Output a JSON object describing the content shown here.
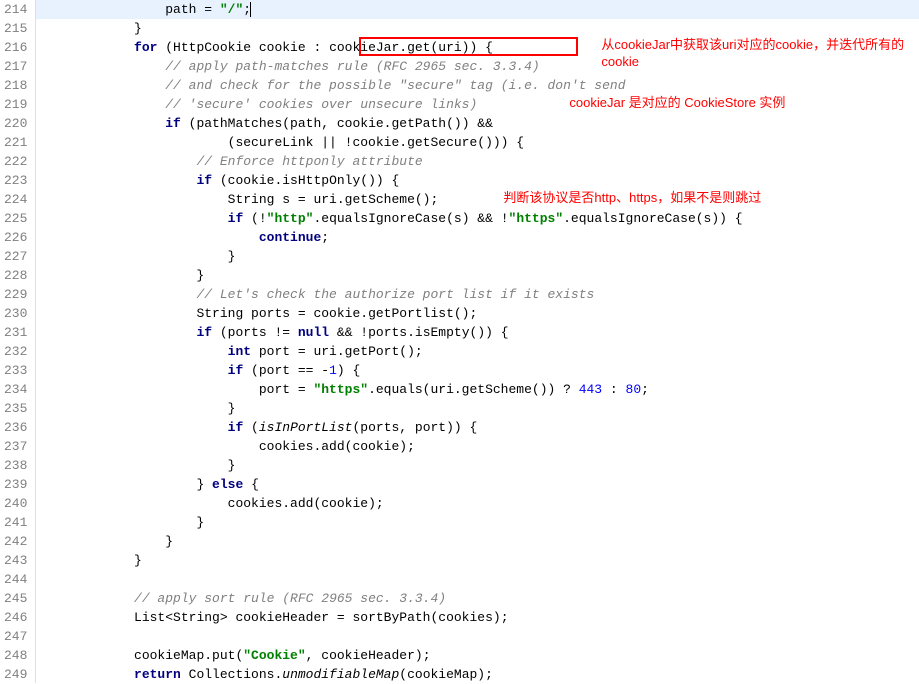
{
  "gutter": {
    "start": 214,
    "end": 249
  },
  "annotations": {
    "a1": "从cookieJar中获取该uri对应的cookie，并迭代所有的cookie",
    "a2": "cookieJar 是对应的 CookieStore 实例",
    "a3": "判断该协议是否http、https，如果不是则跳过"
  },
  "lines": {
    "l214": {
      "indent": "                ",
      "kw": "",
      "a": "path = ",
      "s": "\"/\"",
      "b": ";"
    },
    "l215": {
      "t": "            }"
    },
    "l216": {
      "indent": "            ",
      "kw": "for",
      "a": " (HttpCookie cookie : cookieJar.get(uri)) {"
    },
    "l217": {
      "indent": "                ",
      "cmt": "// apply path-matches rule (RFC 2965 sec. 3.3.4)"
    },
    "l218": {
      "indent": "                ",
      "cmt": "// and check for the possible \"secure\" tag (i.e. don't send"
    },
    "l219": {
      "indent": "                ",
      "cmt": "// 'secure' cookies over unsecure links)"
    },
    "l220": {
      "indent": "                ",
      "kw": "if",
      "a": " (pathMatches(path, cookie.getPath()) &&"
    },
    "l221": {
      "t": "                        (secureLink || !cookie.getSecure())) {"
    },
    "l222": {
      "indent": "                    ",
      "cmt": "// Enforce httponly attribute"
    },
    "l223": {
      "indent": "                    ",
      "kw": "if",
      "a": " (cookie.isHttpOnly()) {"
    },
    "l224": {
      "indent": "                        ",
      "a": "String s = uri.getScheme();"
    },
    "l225": {
      "indent": "                        ",
      "kw": "if",
      "a": " (!",
      "s1": "\"http\"",
      "b": ".equalsIgnoreCase(s) && !",
      "s2": "\"https\"",
      "c": ".equalsIgnoreCase(s)) {"
    },
    "l226": {
      "indent": "                            ",
      "kw": "continue",
      "a": ";"
    },
    "l227": {
      "t": "                        }"
    },
    "l228": {
      "t": "                    }"
    },
    "l229": {
      "indent": "                    ",
      "cmt": "// Let's check the authorize port list if it exists"
    },
    "l230": {
      "indent": "                    ",
      "a": "String ports = cookie.getPortlist();"
    },
    "l231": {
      "indent": "                    ",
      "kw": "if",
      "a": " (ports != ",
      "kw2": "null",
      "b": " && !ports.isEmpty()) {"
    },
    "l232": {
      "indent": "                        ",
      "kw": "int",
      "a": " port = uri.getPort();"
    },
    "l233": {
      "indent": "                        ",
      "kw": "if",
      "a": " (port == -",
      "n": "1",
      "b": ") {"
    },
    "l234": {
      "indent": "                            ",
      "a": "port = ",
      "s": "\"https\"",
      "b": ".equals(uri.getScheme()) ? ",
      "n1": "443",
      "c": " : ",
      "n2": "80",
      "d": ";"
    },
    "l235": {
      "t": "                        }"
    },
    "l236": {
      "indent": "                        ",
      "kw": "if",
      "a": " (",
      "m": "isInPortList",
      "b": "(ports, port)) {"
    },
    "l237": {
      "indent": "                            ",
      "a": "cookies.add(cookie);"
    },
    "l238": {
      "t": "                        }"
    },
    "l239": {
      "indent": "                    ",
      "a": "} ",
      "kw": "else",
      "b": " {"
    },
    "l240": {
      "indent": "                        ",
      "a": "cookies.add(cookie);"
    },
    "l241": {
      "t": "                    }"
    },
    "l242": {
      "t": "                }"
    },
    "l243": {
      "t": "            }"
    },
    "l244": {
      "t": ""
    },
    "l245": {
      "indent": "            ",
      "cmt": "// apply sort rule (RFC 2965 sec. 3.3.4)"
    },
    "l246": {
      "indent": "            ",
      "a": "List<String> cookieHeader = sortByPath(cookies);"
    },
    "l247": {
      "t": ""
    },
    "l248": {
      "indent": "            ",
      "a": "cookieMap.put(",
      "s": "\"Cookie\"",
      "b": ", cookieHeader);"
    },
    "l249": {
      "indent": "            ",
      "kw": "return",
      "a": " Collections.",
      "m": "unmodifiableMap",
      "b": "(cookieMap);"
    }
  }
}
